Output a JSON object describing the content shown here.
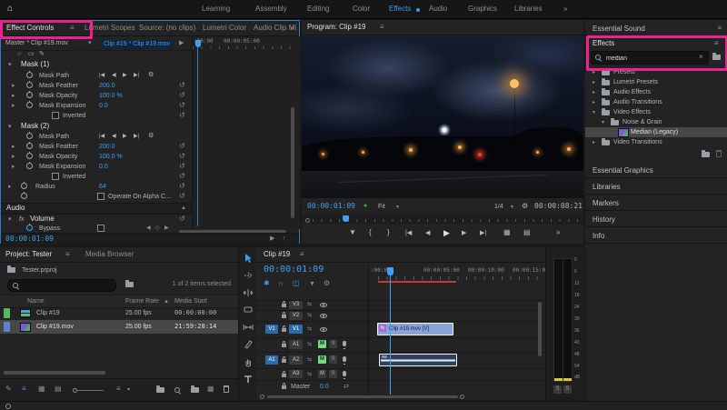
{
  "annotation": {
    "color": "#ed2190"
  },
  "icons": {
    "home": "⌂",
    "menu": "≡",
    "overflow": "»",
    "chev_r": "▸",
    "chev_d": "▾",
    "caret": "▾",
    "reset": "↺",
    "play": "▶",
    "step_back": "◀",
    "step_fwd": "▶",
    "goto_in": "|◀",
    "goto_out": "▶|",
    "brace_in": "{",
    "brace_out": "}",
    "marker": "▼",
    "gear": "⚙",
    "magnet": "∩",
    "link": "◫",
    "nest": "✱",
    "kf_prev": "◀",
    "kf_diamond": "◇",
    "kf_next": "▶",
    "ellipse": "○",
    "rect": "▭",
    "pen": "✎",
    "sort_up": "▲",
    "sync": "⇆",
    "fit_h": "⇄",
    "dot": "●",
    "clear": "×",
    "up": "↑",
    "list": "≡",
    "grid": "▦",
    "free": "▤",
    "collapse": "▲"
  },
  "topbar": {
    "workspaces": [
      "Learning",
      "Assembly",
      "Editing",
      "Color",
      "Effects",
      "Audio",
      "Graphics",
      "Libraries"
    ],
    "active": "Effects"
  },
  "effect_controls": {
    "tabs": [
      "Effect Controls",
      "Lumetri Scopes",
      "Source: (no clips)",
      "Lumetri Color",
      "Audio Clip Mi"
    ],
    "master_clip": "Master * Clip #19.mov",
    "target_clip": "Clip #19 * Clip #19.mov",
    "ruler": {
      "l1": ":00:00",
      "l2": "00:00:05:00"
    },
    "masks": [
      {
        "title": "Mask (1)",
        "path_label": "Mask Path",
        "params": [
          {
            "label": "Mask Feather",
            "value": "200.0"
          },
          {
            "label": "Mask Opacity",
            "value": "100.0 %"
          },
          {
            "label": "Mask Expansion",
            "value": "0.0"
          }
        ],
        "inverted_label": "Inverted"
      },
      {
        "title": "Mask (2)",
        "path_label": "Mask Path",
        "params": [
          {
            "label": "Mask Feather",
            "value": "200.0"
          },
          {
            "label": "Mask Opacity",
            "value": "100.0 %"
          },
          {
            "label": "Mask Expansion",
            "value": "0.0"
          }
        ],
        "inverted_label": "Inverted"
      }
    ],
    "radius": {
      "label": "Radius",
      "value": "64"
    },
    "alpha_label": "Operate On Alpha C...",
    "audio_section": "Audio",
    "volume": {
      "fx": "fx",
      "label": "Volume"
    },
    "bypass_label": "Bypass",
    "timecode": "00:00:01:09"
  },
  "program": {
    "title": "Program: Clip #19",
    "timecode": "00:00:01:09",
    "fit_label": "Fit",
    "playback_res": "1/4",
    "duration": "00:00:08:21"
  },
  "right_panel": {
    "essential_sound_title": "Essential Sound",
    "effects_panel": {
      "title": "Effects",
      "search_value": "median",
      "tree": [
        {
          "label": "Presets"
        },
        {
          "label": "Lumetri Presets"
        },
        {
          "label": "Audio Effects"
        },
        {
          "label": "Audio Transitions"
        },
        {
          "label": "Video Effects"
        },
        {
          "label": "Noise & Grain"
        },
        {
          "label": "Median (Legacy)"
        },
        {
          "label": "Video Transitions"
        }
      ]
    },
    "sections": [
      "Essential Graphics",
      "Libraries",
      "Markers",
      "History",
      "Info"
    ]
  },
  "project": {
    "tabs": [
      "Project: Tester",
      "Media Browser"
    ],
    "bin_name": "Tester.prproj",
    "selection_status": "1 of 2 items selected",
    "columns": {
      "name": "Name",
      "frame_rate": "Frame Rate",
      "media_start": "Media Start"
    },
    "rows": [
      {
        "name": "Clip #19",
        "frame_rate": "25.00 fps",
        "media_start": "00:00:00:00"
      },
      {
        "name": "Clip #19.mov",
        "frame_rate": "25.00 fps",
        "media_start": "21:59:28:14"
      }
    ]
  },
  "timeline": {
    "tab": "Clip #19",
    "timecode": "00:00:01:09",
    "ruler_labels": [
      ":00:00",
      "00:00:05:00",
      "00:00:10:00",
      "00:00:15:00"
    ],
    "tracks": {
      "v3": "V3",
      "v2": "V2",
      "v1": "V1",
      "a1": "A1",
      "a2": "A2",
      "a3": "A3",
      "source_v": "V1",
      "source_a": "A1",
      "master": "Master",
      "master_level": "0.0",
      "mute": "M",
      "solo": "S"
    },
    "video_clip_label": "Clip #19.mov [V]",
    "fx_badge": "fx"
  },
  "meters": {
    "db_labels": [
      "0",
      "6",
      "12",
      "18",
      "24",
      "30",
      "36",
      "42",
      "48",
      "54"
    ],
    "bottom_label": "dB",
    "solo_left": "S",
    "solo_right": "S"
  }
}
